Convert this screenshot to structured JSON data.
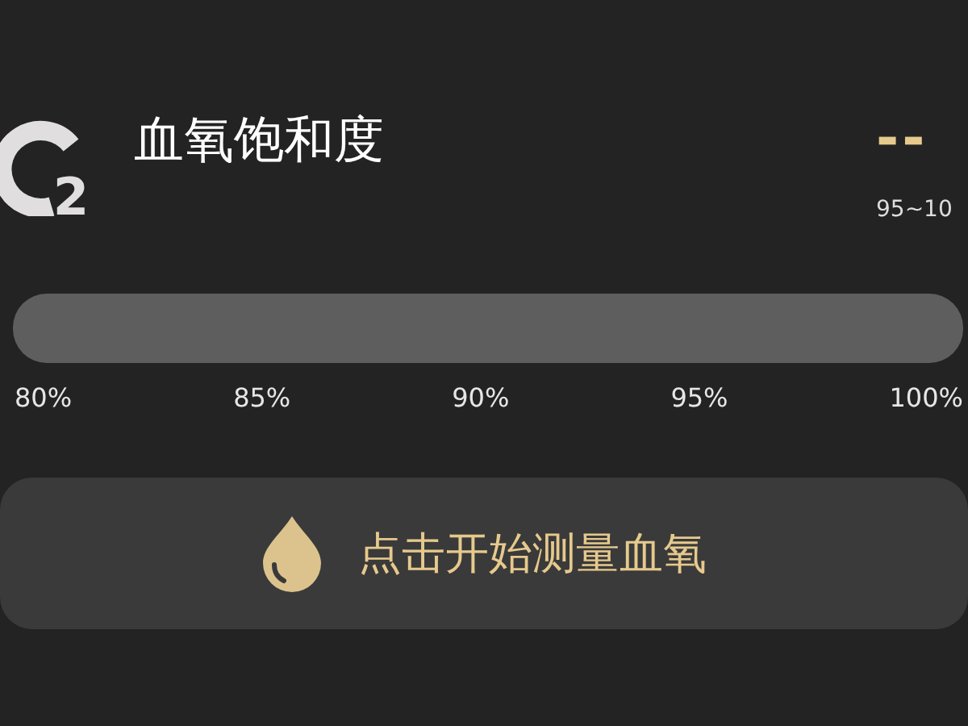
{
  "header": {
    "icon_text": "2",
    "title": "血氧饱和度",
    "value": "--",
    "range": "95~10"
  },
  "scale": {
    "ticks": [
      "80%",
      "85%",
      "90%",
      "95%",
      "100%"
    ]
  },
  "button": {
    "label": "点击开始测量血氧"
  }
}
